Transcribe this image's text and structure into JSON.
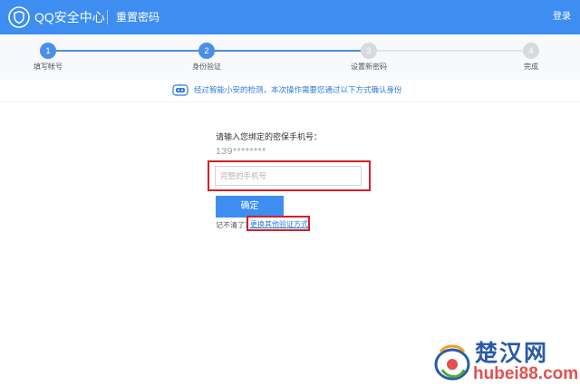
{
  "header": {
    "brand": "QQ安全中心",
    "page_name": "重置密码",
    "login_label": "登录",
    "logo_icon": "shield-icon",
    "bg_color": "#3d8ef0"
  },
  "steps": [
    {
      "number": "1",
      "label": "填写帐号",
      "status": "done"
    },
    {
      "number": "2",
      "label": "身份验证",
      "status": "current"
    },
    {
      "number": "3",
      "label": "设置新密码",
      "status": "todo"
    },
    {
      "number": "4",
      "label": "完成",
      "status": "todo"
    }
  ],
  "notice": {
    "icon": "robot-icon",
    "text": "经过智能小安的检测，本次操作需要您通过以下方式确认身份"
  },
  "form": {
    "prompt": "请输入您绑定的密保手机号：",
    "masked_phone": "139********",
    "phone_placeholder": "完整的手机号",
    "phone_value": "",
    "confirm_label": "确定",
    "forgot_label": "记不清了？",
    "switch_label": "更换其他验证方式"
  },
  "watermark": {
    "site_name": "楚汉网",
    "domain": "hubei88.com"
  },
  "colors": {
    "accent": "#3d8ef0",
    "highlight": "#d42027",
    "link": "#2f7bd6",
    "step_pending": "#d6d9de"
  }
}
